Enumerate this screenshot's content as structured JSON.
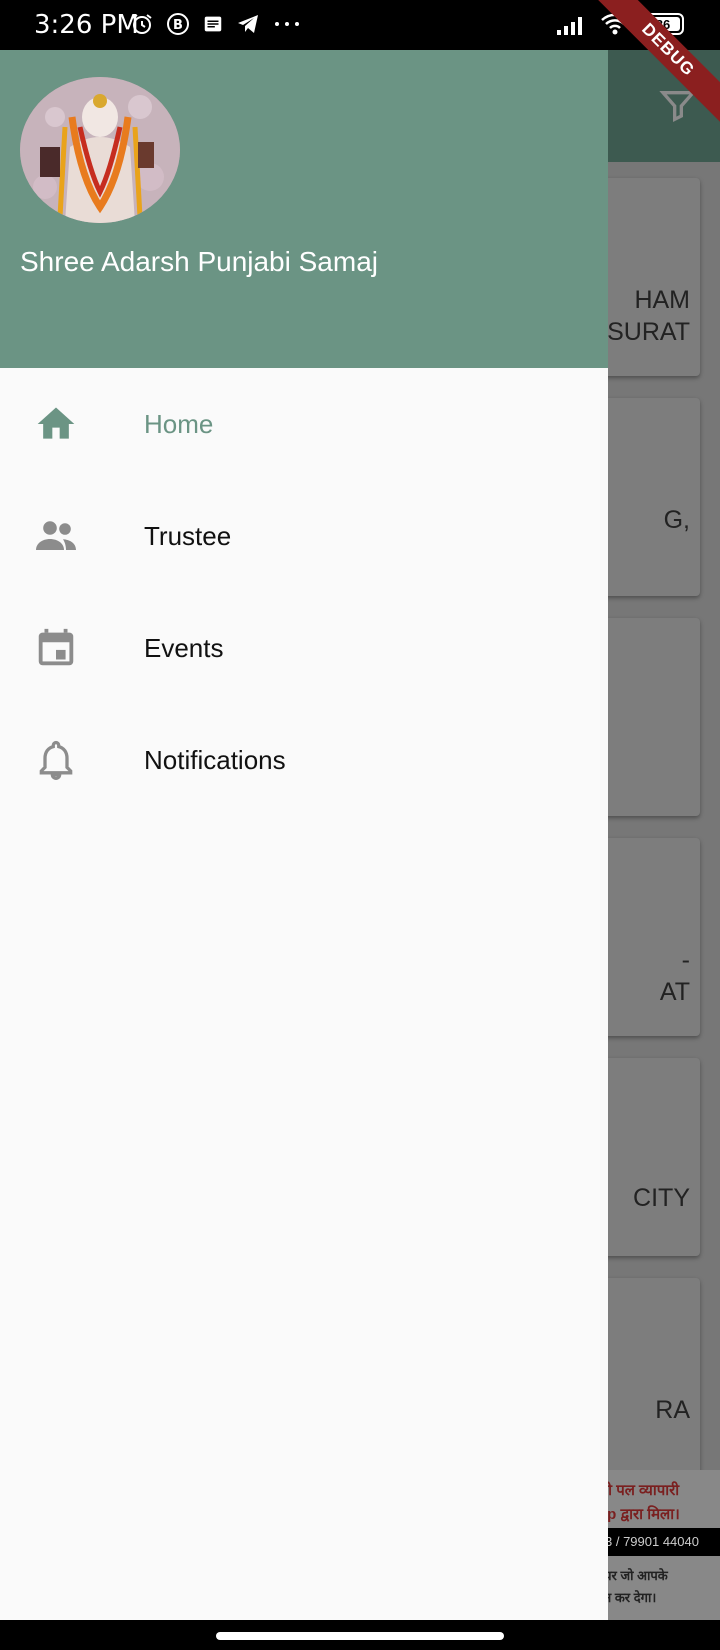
{
  "status_bar": {
    "time": "3:26 PM",
    "icons_left": [
      "alarm-icon",
      "b-icon",
      "message-icon",
      "telegram-icon",
      "more-dots-icon"
    ],
    "icons_right": [
      "signal-icon",
      "wifi-icon",
      "battery-icon"
    ],
    "battery": "86"
  },
  "debug_banner": "DEBUG",
  "drawer": {
    "title": "Shree Adarsh Punjabi Samaj",
    "avatar": "deity-image",
    "accent": "#6b9484",
    "items": [
      {
        "label": "Home",
        "icon": "home-icon",
        "active": true
      },
      {
        "label": "Trustee",
        "icon": "people-icon",
        "active": false
      },
      {
        "label": "Events",
        "icon": "calendar-icon",
        "active": false
      },
      {
        "label": "Notifications",
        "icon": "bell-icon",
        "active": false
      }
    ]
  },
  "background": {
    "appbar_icon": "filter-icon",
    "cards": [
      {
        "line1": "HAM",
        "line2": "SURAT"
      },
      {
        "line1": "G,",
        "line2": ""
      },
      {
        "line1": "",
        "line2": ""
      },
      {
        "line1": "-",
        "line2": "AT"
      },
      {
        "line1": "CITY",
        "line2": ""
      },
      {
        "line1": "RA",
        "line2": ""
      }
    ],
    "ad": {
      "line1": "सी पल व्यापारी",
      "line2": "pp द्वारा मिला।",
      "strip": "3 / 79901 44040",
      "line3": "यर जो आपके",
      "line4": "न कर देगा।"
    }
  }
}
